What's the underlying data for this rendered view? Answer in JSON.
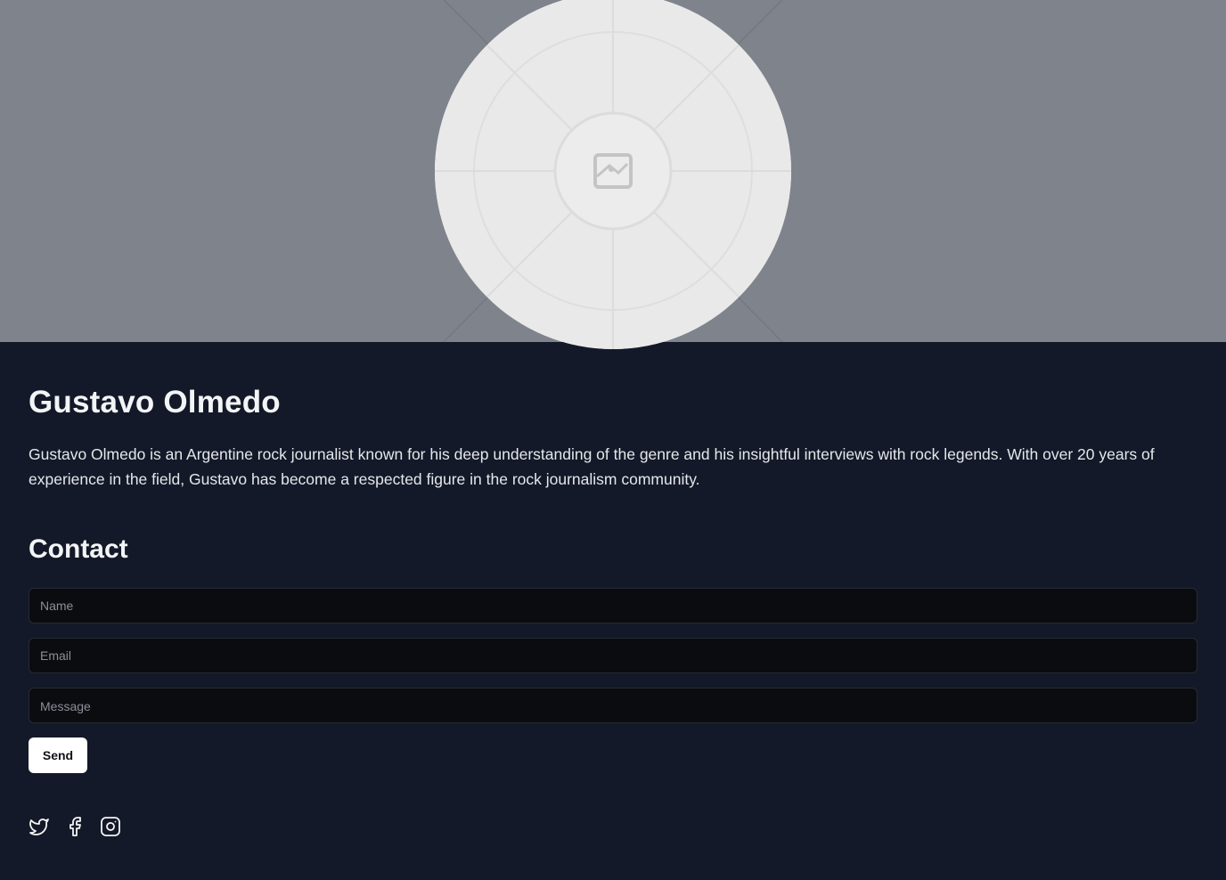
{
  "profile": {
    "name": "Gustavo Olmedo",
    "bio": "Gustavo Olmedo is an Argentine rock journalist known for his deep understanding of the genre and his insightful interviews with rock legends. With over 20 years of experience in the field, Gustavo has become a respected figure in the rock journalism community.",
    "avatar_icon": "image-placeholder-icon"
  },
  "contact": {
    "title": "Contact",
    "name_placeholder": "Name",
    "email_placeholder": "Email",
    "message_placeholder": "Message",
    "send_label": "Send"
  },
  "socials": [
    {
      "icon": "twitter-icon"
    },
    {
      "icon": "facebook-icon"
    },
    {
      "icon": "instagram-icon"
    }
  ],
  "colors": {
    "hero_background": "#7f838c",
    "page_background": "#131928",
    "input_background": "#0b0c10",
    "button_background": "#ffffff"
  }
}
